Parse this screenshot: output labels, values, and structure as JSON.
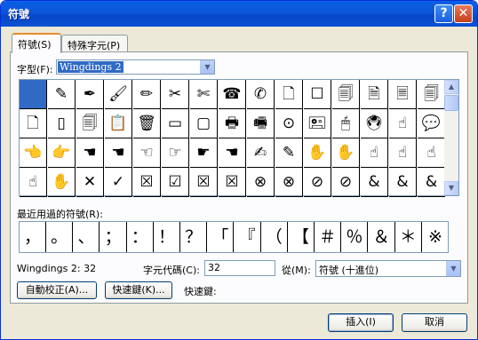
{
  "window": {
    "title": "符號",
    "help_glyph": "?",
    "close_glyph": "✕"
  },
  "tabs": [
    {
      "label": "符號(S)"
    },
    {
      "label": "特殊字元(P)"
    }
  ],
  "font": {
    "label": "字型(F):",
    "value": "Wingdings 2"
  },
  "symbols": [
    "",
    "✎",
    "✒",
    "🖌",
    "✏",
    "✂",
    "✄",
    "☎",
    "✆",
    "🗋",
    "☐",
    "🗐",
    "🗎",
    "🗏",
    "🗐",
    "🗋",
    "▯",
    "🗐",
    "📋",
    "🗑",
    "▭",
    "▢",
    "🖶",
    "🖷",
    "⊙",
    "🖭",
    "🖱",
    "🖲",
    "☝",
    "💬",
    "👈",
    "👉",
    "☚",
    "☚",
    "☜",
    "☞",
    "☛",
    "☚",
    "✍",
    "✎",
    "✋",
    "✋",
    "☝",
    "☝",
    "☝",
    "☝",
    "✋",
    "✕",
    "✓",
    "☒",
    "☑",
    "☒",
    "☒",
    "⊗",
    "⊗",
    "⊘",
    "⊘",
    "&",
    "&",
    "&",
    "&",
    "?",
    "?",
    "?"
  ],
  "recent": {
    "label": "最近用過的符號(R):",
    "items": [
      "，",
      "。",
      "、",
      "；",
      "：",
      "！",
      "？",
      "「",
      "『",
      "（",
      "【",
      "＃",
      "％",
      "＆",
      "＊",
      "※"
    ]
  },
  "status": {
    "font_code": "Wingdings 2: 32"
  },
  "char_code": {
    "label": "字元代碼(C):",
    "value": "32"
  },
  "from": {
    "label": "從(M):",
    "value": "符號 (十進位)"
  },
  "buttons": {
    "autocorrect": "自動校正(A)...",
    "shortcut_key": "快速鍵(K)...",
    "shortcut_label": "快速鍵:",
    "insert": "插入(I)",
    "cancel": "取消"
  }
}
